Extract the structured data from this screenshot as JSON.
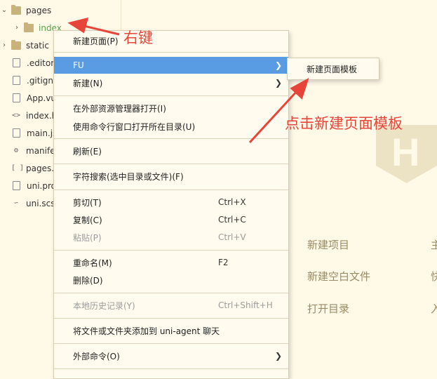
{
  "tree": [
    {
      "label": "pages",
      "chevron": "⌄",
      "icon": "folder-icon"
    },
    {
      "label": "index",
      "chevron": "›",
      "icon": "folder-icon"
    },
    {
      "label": "static",
      "chevron": "›",
      "icon": "folder-icon"
    },
    {
      "label": ".editor",
      "icon": "file-icon"
    },
    {
      "label": ".gitign",
      "icon": "file-icon"
    },
    {
      "label": "App.vu",
      "icon": "file-icon"
    },
    {
      "label": "index.h",
      "icon": "code-icon"
    },
    {
      "label": "main.js",
      "icon": "file-icon"
    },
    {
      "label": "manife",
      "icon": "settings-file-icon"
    },
    {
      "label": "pages.",
      "icon": "json-icon"
    },
    {
      "label": "uni.pro",
      "icon": "file-icon"
    },
    {
      "label": "uni.scs",
      "icon": "link-icon"
    }
  ],
  "menu": {
    "new_page": "新建页面(P)",
    "fu": "FU",
    "new": "新建(N)",
    "open_explorer": "在外部资源管理器打开(I)",
    "open_terminal": "使用命令行窗口打开所在目录(U)",
    "refresh": "刷新(E)",
    "search": "字符搜索(选中目录或文件)(F)",
    "cut": "剪切(T)",
    "cut_sc": "Ctrl+X",
    "copy": "复制(C)",
    "copy_sc": "Ctrl+C",
    "paste": "粘贴(P)",
    "paste_sc": "Ctrl+V",
    "rename": "重命名(M)",
    "rename_sc": "F2",
    "delete": "删除(D)",
    "history": "本地历史记录(Y)",
    "history_sc": "Ctrl+Shift+H",
    "add_to_agent": "将文件或文件夹添加到 uni-agent 聊天",
    "external": "外部命令(O)"
  },
  "submenu": {
    "new_page_template": "新建页面模板"
  },
  "welcome": {
    "new_project": "新建项目",
    "new_blank_file": "新建空白文件",
    "open_dir": "打开目录",
    "right_1": "主",
    "right_2": "快",
    "right_3": "入",
    "logo_letter": "H"
  },
  "annotations": {
    "right_click": "右键",
    "click_template": "点击新建页面模板"
  },
  "colors": {
    "accent": "#5a9ce4",
    "annotation": "#e8453a",
    "background": "#fffae8"
  }
}
